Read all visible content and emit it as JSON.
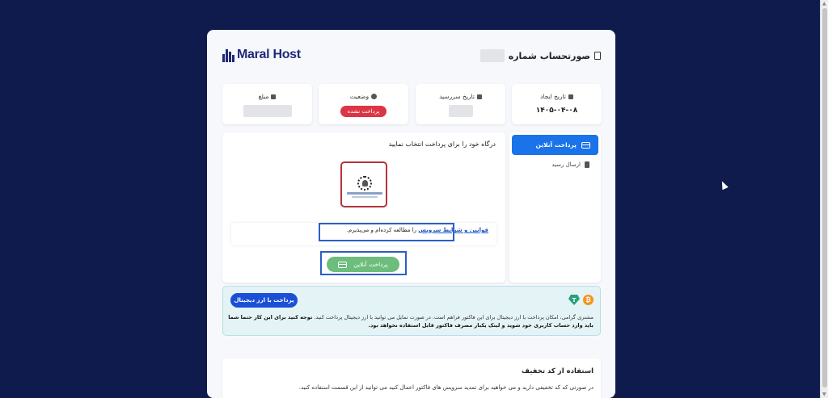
{
  "brand": {
    "logo_text": "Maral Host"
  },
  "invoice": {
    "title": "صورتحساب شماره"
  },
  "info": {
    "created": {
      "label": "تاریخ ایجاد",
      "value": "۱۴۰۵-۰۴-۰۸"
    },
    "due": {
      "label": "تاریخ سررسید"
    },
    "status": {
      "label": "وضعیت",
      "value": "پرداخت نشده"
    },
    "amount": {
      "label": "مبلغ"
    }
  },
  "sidebar": {
    "tabs": [
      {
        "label": "پرداخت آنلاین",
        "icon": "credit-card-icon",
        "active": true
      },
      {
        "label": "ارسال رسید",
        "icon": "file-icon",
        "active": false
      }
    ]
  },
  "payment": {
    "gateway_title": "درگاه خود را برای پرداخت انتخاب نمایید",
    "terms_link": "قوانین و شرایط سرویس",
    "terms_suffix": "را مطالعه کرده‌ام و می‌پذیرم.",
    "pay_button": "پرداخت آنلاین"
  },
  "crypto": {
    "button": "پرداخت با ارز دیجیتال",
    "text": "مشتری گرامی، امکان پرداخت با ارز دیجیتال برای این فاکتور فراهم است. در صورت تمایل می توانید با ارز دیجیتال پرداخت کنید.",
    "bold": "توجه کنید برای این کار حتما شما باید وارد حساب کاربری خود شوید و لینک یکبار مصرف فاکتور قابل استفاده نخواهد بود."
  },
  "discount": {
    "title": "استفاده از کد تخفیف",
    "description": "در صورتی که کد تخفیفی دارید و می خواهید برای تمدید سرویس های فاکتور اعمال کنید می توانید از این قسمت استفاده کنید."
  },
  "colors": {
    "background": "#0f1b4d",
    "primary": "#1a73e8",
    "danger": "#dc3545",
    "success": "#6dbd7c",
    "crypto_bg": "#e4f3f6"
  }
}
